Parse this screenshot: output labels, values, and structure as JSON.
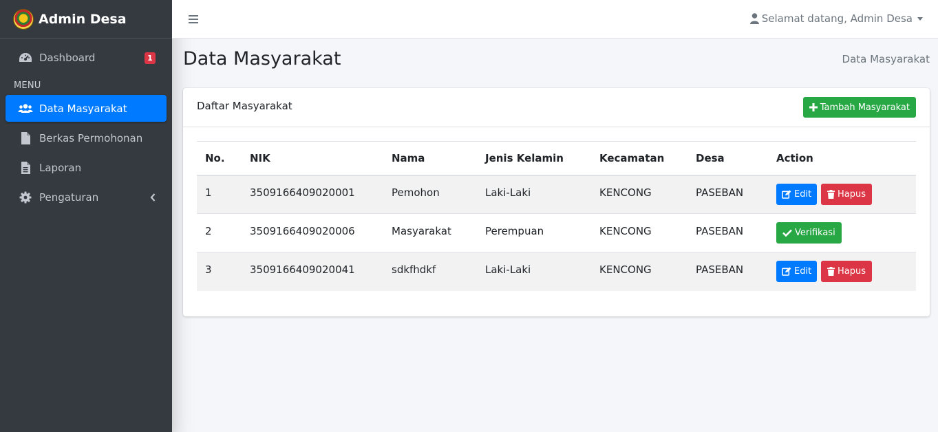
{
  "brand": {
    "title": "Admin Desa",
    "logo_icon": "village-emblem-icon"
  },
  "sidebar": {
    "items": [
      {
        "label": "Dashboard",
        "icon": "tachometer-icon",
        "badge": "1"
      },
      {
        "label": "Data Masyarakat",
        "icon": "users-icon",
        "active": true
      },
      {
        "label": "Berkas Permohonan",
        "icon": "file-icon"
      },
      {
        "label": "Laporan",
        "icon": "file-text-icon"
      },
      {
        "label": "Pengaturan",
        "icon": "gear-icon",
        "chevron": "chevron-left-icon"
      }
    ],
    "menu_header": "MENU"
  },
  "topbar": {
    "toggle_icon": "hamburger-icon",
    "user_greeting": "Selamat datang, Admin Desa"
  },
  "page": {
    "title": "Data Masyarakat",
    "breadcrumb": "Data Masyarakat"
  },
  "card": {
    "title": "Daftar Masyarakat",
    "add_button": "Tambah Masyarakat",
    "table": {
      "headers": [
        "No.",
        "NIK",
        "Nama",
        "Jenis Kelamin",
        "Kecamatan",
        "Desa",
        "Action"
      ],
      "rows": [
        {
          "no": "1",
          "nik": "3509166409020001",
          "nama": "Pemohon",
          "jk": "Laki-Laki",
          "kecamatan": "KENCONG",
          "desa": "PASEBAN",
          "actions": [
            "Edit",
            "Hapus"
          ]
        },
        {
          "no": "2",
          "nik": "3509166409020006",
          "nama": "Masyarakat",
          "jk": "Perempuan",
          "kecamatan": "KENCONG",
          "desa": "PASEBAN",
          "actions": [
            "Verifikasi"
          ]
        },
        {
          "no": "3",
          "nik": "3509166409020041",
          "nama": "sdkfhdkf",
          "jk": "Laki-Laki",
          "kecamatan": "KENCONG",
          "desa": "PASEBAN",
          "actions": [
            "Edit",
            "Hapus"
          ]
        }
      ]
    }
  },
  "colors": {
    "sidebar_bg": "#343a40",
    "primary": "#007bff",
    "success": "#28a745",
    "danger": "#dc3545"
  }
}
